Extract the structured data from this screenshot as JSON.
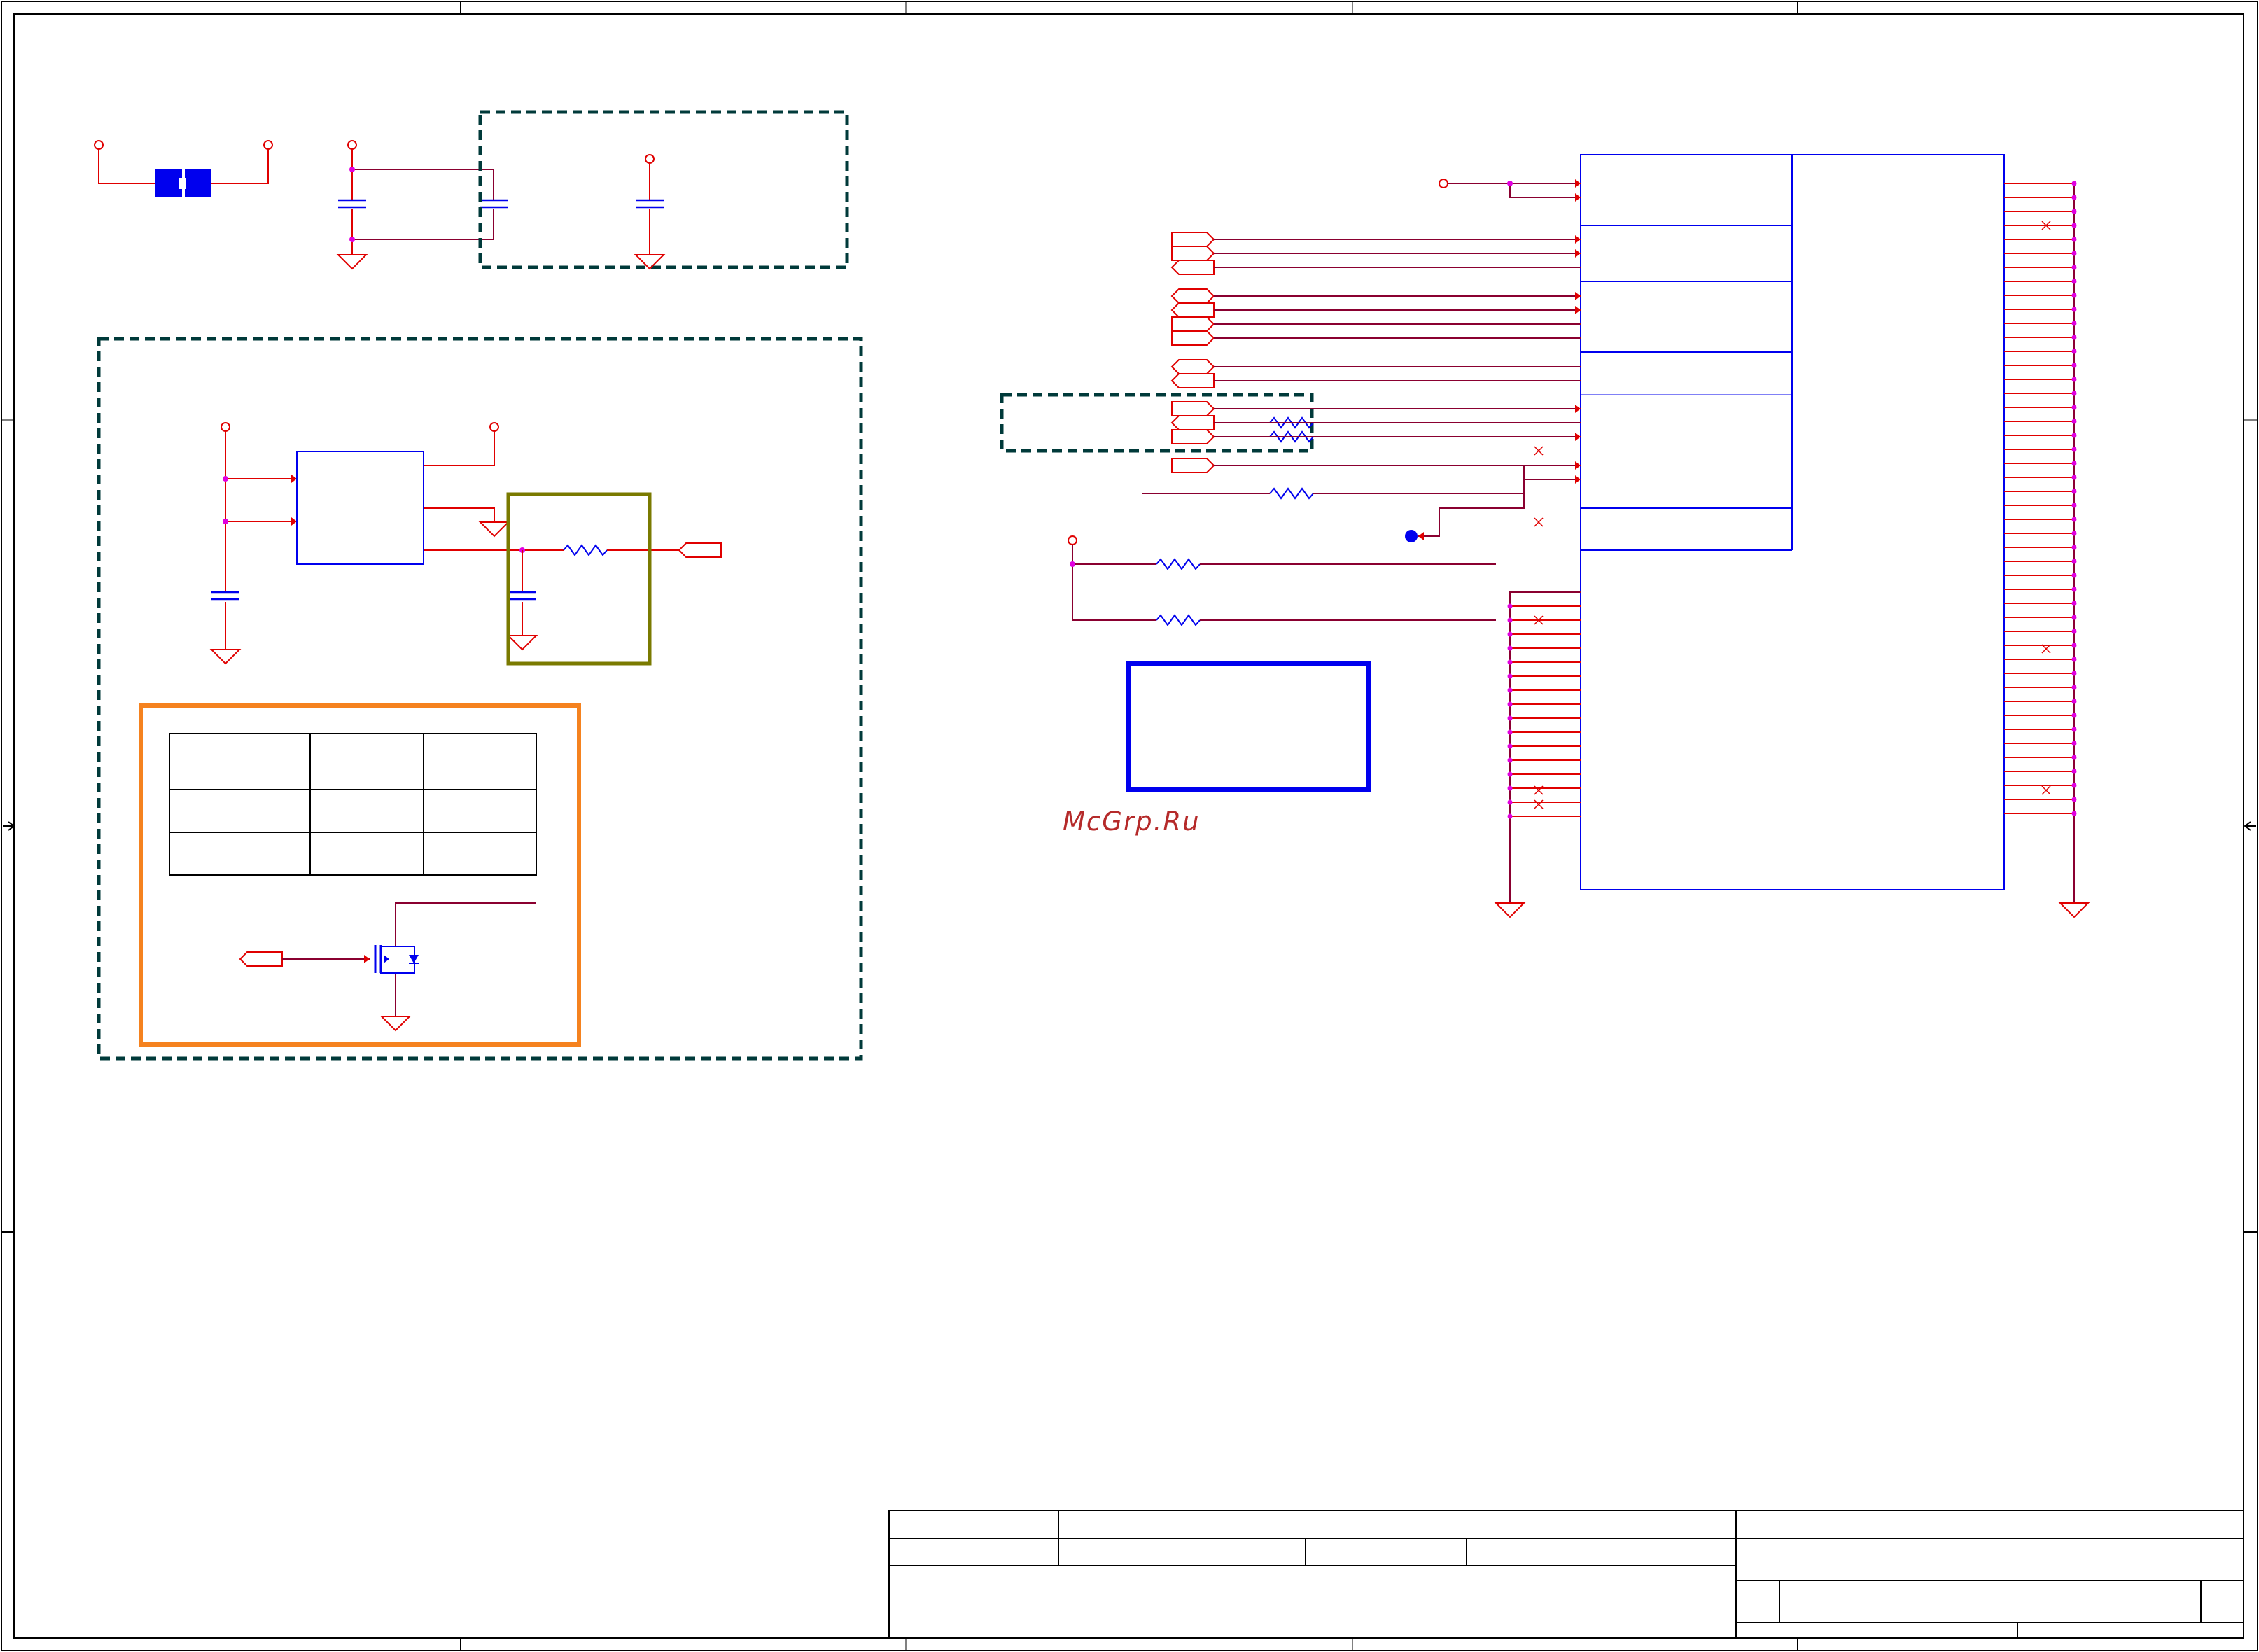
{
  "watermark": "McGrp.Ru",
  "colors": {
    "wire": "#e00000",
    "wire_dark": "#8a0030",
    "junction": "#e000e0",
    "component": "#0000ee",
    "frame": "#000000",
    "group_dashed": "#003a3a",
    "group_orange": "#f5821f",
    "group_olive": "#7a7a00"
  },
  "icons": [
    "ground-icon",
    "capacitor-icon",
    "resistor-icon",
    "port-icon",
    "power-pin-icon",
    "mosfet-icon",
    "fuse-icon",
    "no-connect-icon"
  ]
}
